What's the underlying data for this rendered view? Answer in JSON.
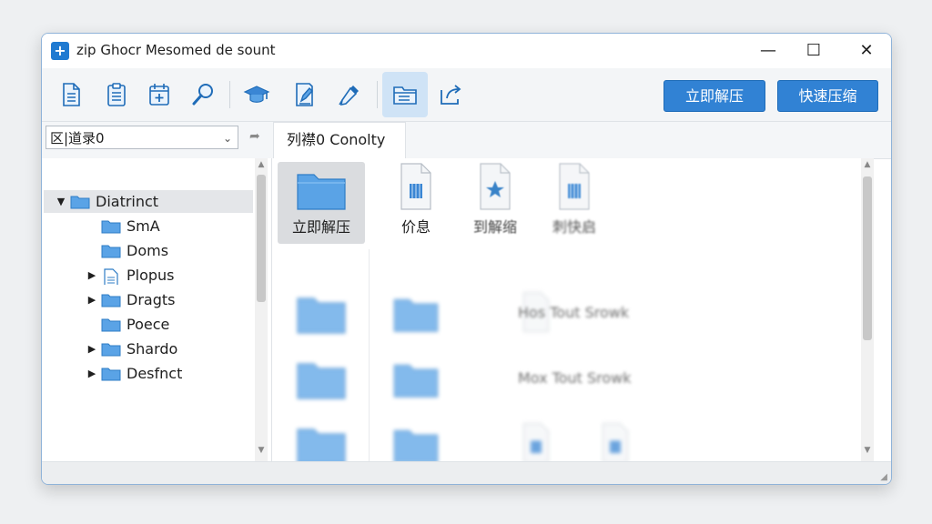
{
  "window": {
    "title": "zip Ghocr Mesomed de sount"
  },
  "window_controls": {
    "minimize": "—",
    "maximize": "☐",
    "close": "✕"
  },
  "toolbar": {
    "buttons": [
      {
        "icon": "document-icon"
      },
      {
        "icon": "clipboard-icon"
      },
      {
        "icon": "calendar-add-icon"
      },
      {
        "icon": "search-icon"
      },
      {
        "icon": "graduation-cap-icon"
      },
      {
        "icon": "edit-document-icon"
      },
      {
        "icon": "eyedropper-icon"
      },
      {
        "icon": "folder-open-icon",
        "active": true
      },
      {
        "icon": "share-export-icon"
      }
    ],
    "extract_label": "立即解压",
    "quick_compress_label": "快速压缩"
  },
  "address": {
    "value": "区|道录0",
    "tab_label": "列襟0 Conolty"
  },
  "tree": {
    "items": [
      {
        "label": "Diatrinct",
        "expanded": true,
        "selected": true,
        "level": 0
      },
      {
        "label": "SmA",
        "level": 1
      },
      {
        "label": "Doms",
        "level": 1
      },
      {
        "label": "Plopus",
        "level": 1,
        "has_children": true,
        "icon": "file"
      },
      {
        "label": "Dragts",
        "level": 1,
        "has_children": true
      },
      {
        "label": "Poece",
        "level": 1
      },
      {
        "label": "Shardo",
        "level": 1,
        "has_children": true
      },
      {
        "label": "Desfnct",
        "level": 1,
        "has_children": true
      }
    ]
  },
  "content": {
    "row1": [
      {
        "label": "立即解压",
        "icon": "folder-icon",
        "selected": true
      },
      {
        "label": "价息",
        "icon": "archive-file-icon"
      },
      {
        "label": "到解缩",
        "icon": "star-file-icon"
      },
      {
        "label": "刺快启",
        "icon": "archive-file-icon"
      }
    ],
    "blurred_texts": [
      "Hos Tout Srowk",
      "Mox Tout Srowk"
    ]
  },
  "colors": {
    "accent": "#3182d4",
    "folder": "#5aa3e6",
    "selection": "#e4e6e9"
  }
}
